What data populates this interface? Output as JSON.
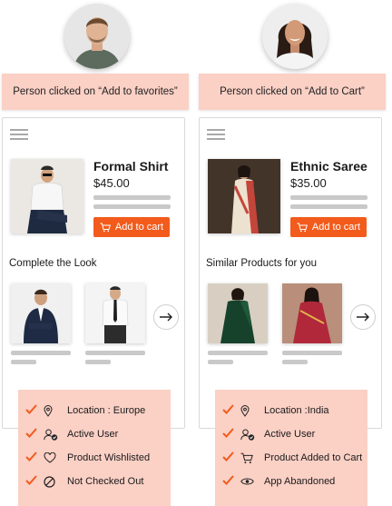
{
  "left": {
    "caption_prefix": "Person clicked on ",
    "caption_action": "“Add to favorites”",
    "product": {
      "title": "Formal Shirt",
      "price": "$45.00",
      "button": "Add to cart"
    },
    "section_title": "Complete the Look",
    "attributes": [
      {
        "icon": "location-pin-icon",
        "text": "Location : Europe"
      },
      {
        "icon": "user-check-icon",
        "text": "Active User"
      },
      {
        "icon": "heart-icon",
        "text": "Product Wishlisted"
      },
      {
        "icon": "prohibited-icon",
        "text": "Not Checked Out"
      }
    ]
  },
  "right": {
    "caption_prefix": "Person clicked on ",
    "caption_action": "“Add to Cart”",
    "product": {
      "title": "Ethnic Saree",
      "price": "$35.00",
      "button": "Add to cart"
    },
    "section_title": "Similar Products for you",
    "attributes": [
      {
        "icon": "location-pin-icon",
        "text": "Location :India"
      },
      {
        "icon": "user-check-icon",
        "text": "Active User"
      },
      {
        "icon": "cart-icon",
        "text": "Product Added to Cart"
      },
      {
        "icon": "eye-icon",
        "text": "App Abandoned"
      }
    ]
  },
  "colors": {
    "accent": "#f25b1c",
    "highlight": "#fbd0c5",
    "skeleton": "#c9c9c9"
  }
}
